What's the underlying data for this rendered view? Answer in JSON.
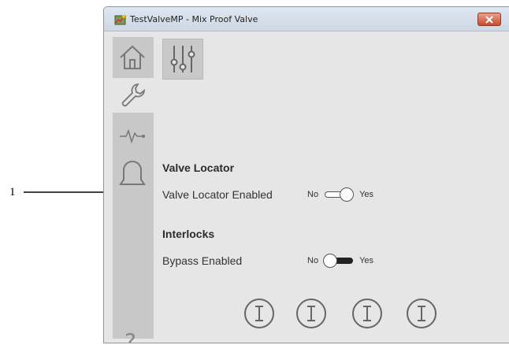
{
  "callout": {
    "number": "1"
  },
  "window": {
    "title": "TestValveMP - Mix Proof Valve"
  },
  "sidebar": {
    "items": [
      {
        "name": "home",
        "icon": "home-icon"
      },
      {
        "name": "maintenance",
        "icon": "wrench-icon",
        "active": true
      },
      {
        "name": "trends",
        "icon": "trend-icon"
      },
      {
        "name": "alarms",
        "icon": "bell-icon"
      }
    ],
    "help_label": "?"
  },
  "toolbar": {
    "icon": "sliders-icon"
  },
  "valve_locator": {
    "title": "Valve Locator",
    "enabled_label": "Valve Locator Enabled",
    "no_label": "No",
    "yes_label": "Yes",
    "value": "No"
  },
  "interlocks": {
    "title": "Interlocks",
    "bypass_label": "Bypass Enabled",
    "no_label": "No",
    "yes_label": "Yes",
    "value": "No"
  },
  "info_buttons": [
    "I",
    "I",
    "I",
    "I"
  ],
  "colors": {
    "toggle_off_track": "#ffffff",
    "toggle_dark_track": "#222222",
    "close_button": "#c74b2f",
    "background": "#e6e6e6",
    "sidebar": "#c8c8c8"
  }
}
